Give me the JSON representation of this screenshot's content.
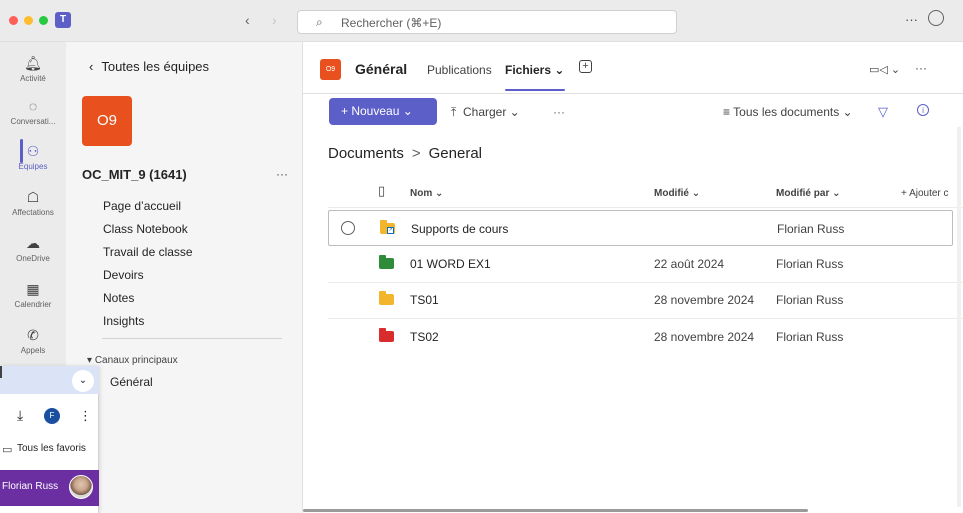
{
  "titlebar": {
    "search_placeholder": "Rechercher (⌘+E)",
    "more": "···"
  },
  "rail": {
    "items": [
      {
        "label": "Activité",
        "icon": "bell-icon"
      },
      {
        "label": "Conversati...",
        "icon": "chat-icon"
      },
      {
        "label": "Équipes",
        "icon": "teams-icon"
      },
      {
        "label": "Affectations",
        "icon": "assignments-icon"
      },
      {
        "label": "OneDrive",
        "icon": "cloud-icon"
      },
      {
        "label": "Calendrier",
        "icon": "calendar-icon"
      },
      {
        "label": "Appels",
        "icon": "phone-icon"
      }
    ]
  },
  "team_panel": {
    "back_label": "Toutes les équipes",
    "avatar": "O9",
    "team_name": "OC_MIT_9 (1641)",
    "more": "···",
    "links": [
      "Page d’accueil",
      "Class Notebook",
      "Travail de classe",
      "Devoirs",
      "Notes",
      "Insights"
    ],
    "channels_heading": "Canaux principaux",
    "channel": "Général"
  },
  "overlay": {
    "favorites": "Tous les favoris",
    "user_initial": "F",
    "user_name": "Florian Russ"
  },
  "header": {
    "channel_avatar": "O9",
    "channel_name": "Général",
    "tabs": [
      "Publications",
      "Fichiers ⌄"
    ]
  },
  "commands": {
    "new": "+ Nouveau ⌄",
    "upload": "Charger ⌄",
    "more": "···",
    "view": "Tous les documents ⌄"
  },
  "breadcrumb": {
    "root": "Documents",
    "separator": ">",
    "current": "General"
  },
  "table": {
    "columns": [
      "Nom ⌄",
      "Modifié ⌄",
      "Modifié par ⌄",
      "+ Ajouter c"
    ],
    "rows": [
      {
        "name": "Supports de cours",
        "modified": "",
        "modified_by": "Florian Russ",
        "folder_color": "#f3b52c",
        "shortcut": true
      },
      {
        "name": "01 WORD EX1",
        "modified": "22 août 2024",
        "modified_by": "Florian Russ",
        "folder_color": "#2e8b3a",
        "shortcut": false
      },
      {
        "name": "TS01",
        "modified": "28 novembre 2024",
        "modified_by": "Florian Russ",
        "folder_color": "#f3b52c",
        "shortcut": false
      },
      {
        "name": "TS02",
        "modified": "28 novembre 2024",
        "modified_by": "Florian Russ",
        "folder_color": "#d92c2c",
        "shortcut": false
      }
    ]
  },
  "colors": {
    "accent": "#5b5fc7",
    "team_avatar": "#e8501e",
    "overlay_user_bar": "#6b2fa2"
  }
}
